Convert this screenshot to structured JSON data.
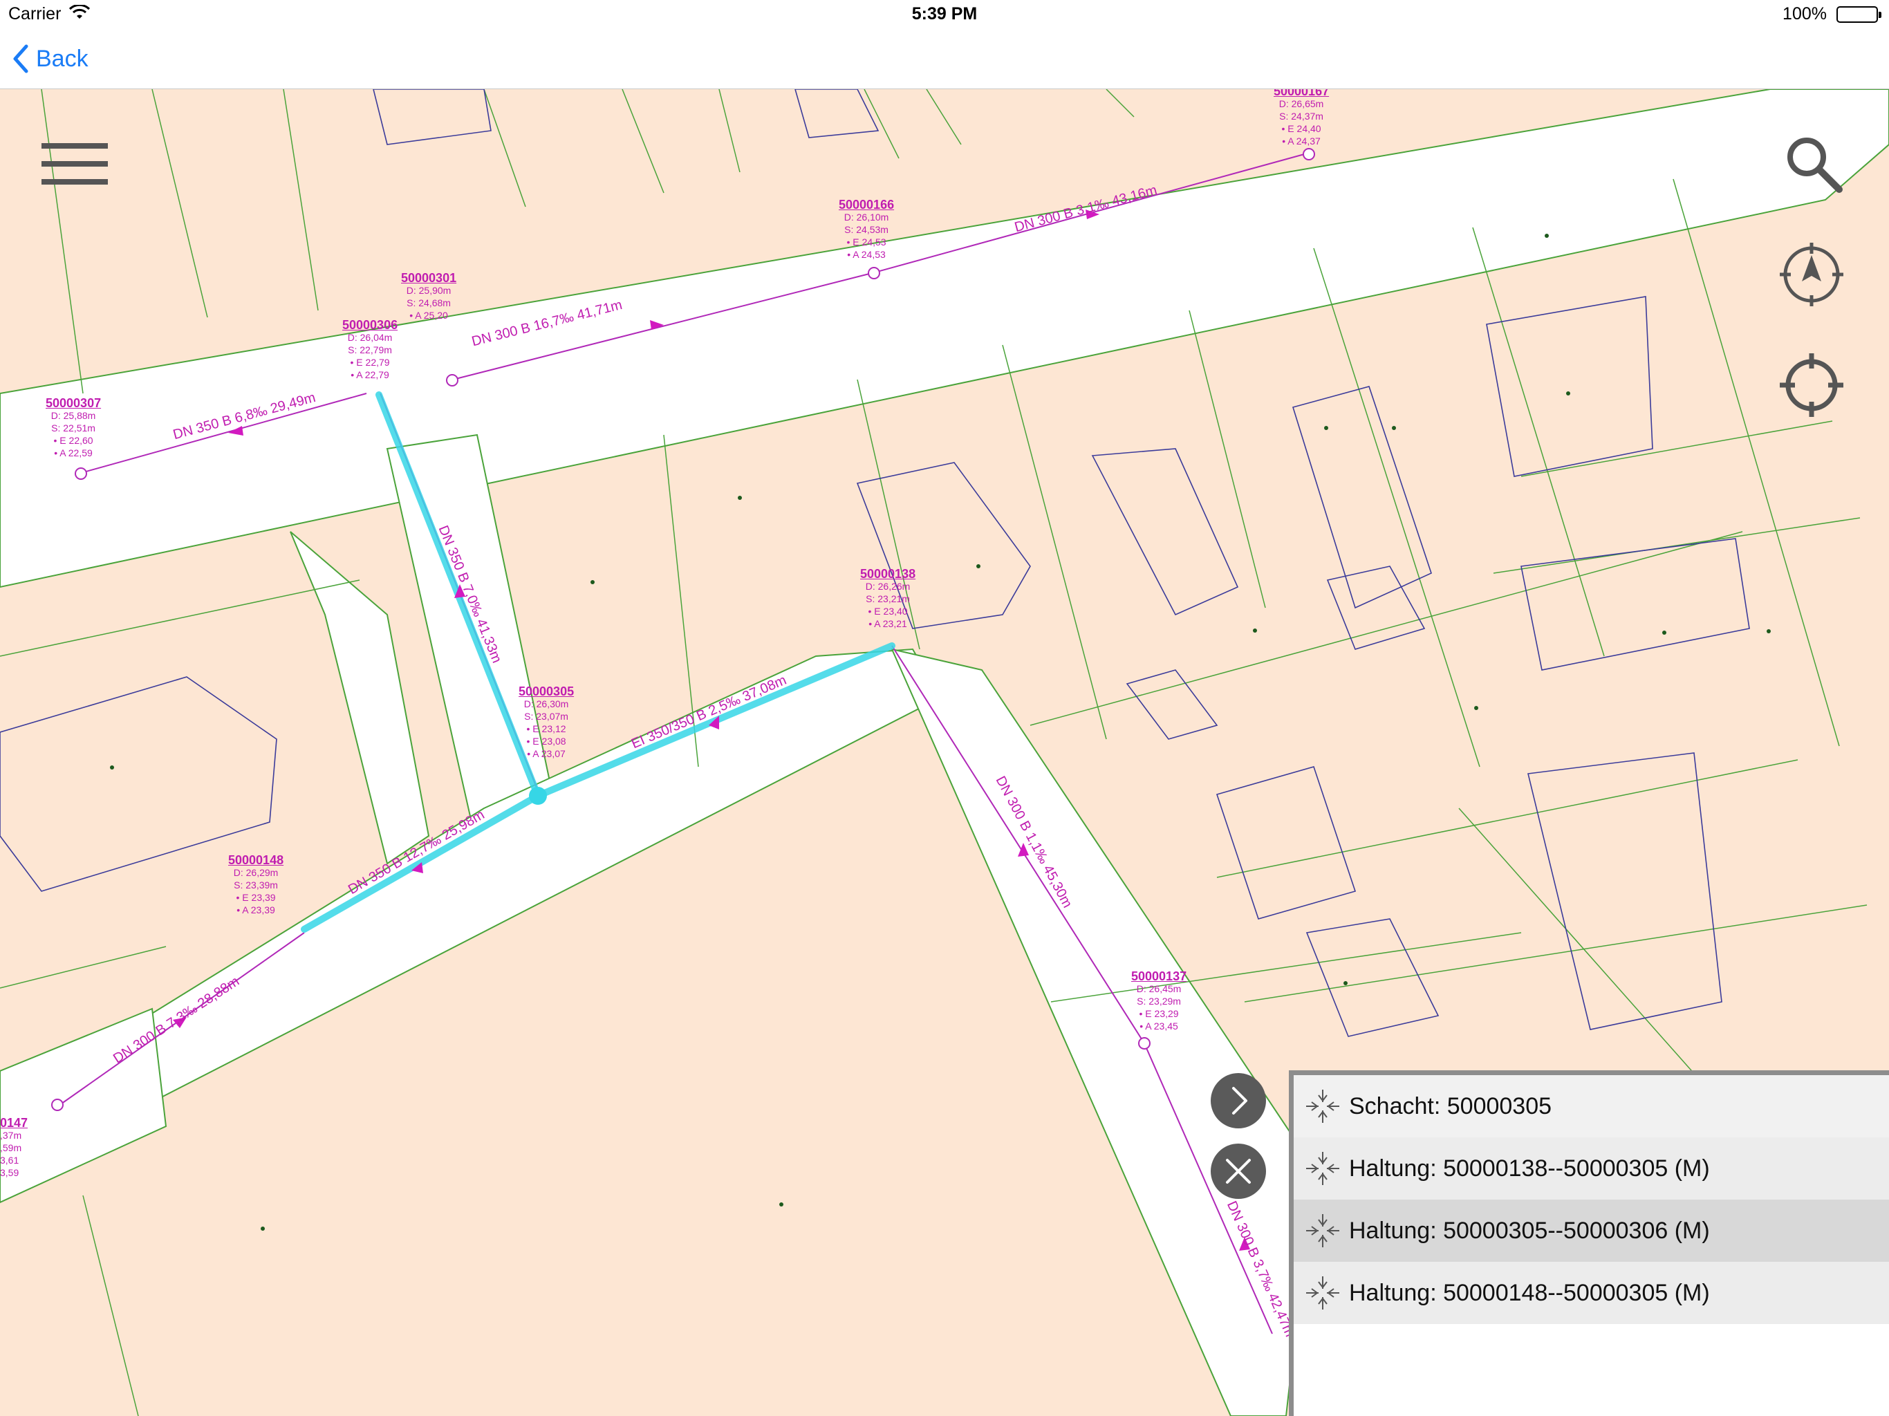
{
  "status_bar": {
    "carrier": "Carrier",
    "time": "5:39 PM",
    "battery": "100%"
  },
  "nav": {
    "back_label": "Back"
  },
  "map": {
    "manholes": [
      {
        "id": "50000301",
        "details": [
          "D: 25,90m",
          "S: 24,68m",
          "• A 25,20"
        ]
      },
      {
        "id": "50000306",
        "details": [
          "D: 26,04m",
          "S: 22,79m",
          "• E 22,79",
          "• A 22,79"
        ]
      },
      {
        "id": "50000307",
        "details": [
          "D: 25,88m",
          "S: 22,51m",
          "• E 22,60",
          "• A 22,59"
        ]
      },
      {
        "id": "50000166",
        "details": [
          "D: 26,10m",
          "S: 24,53m",
          "• E 24,53",
          "• A 24,53"
        ]
      },
      {
        "id": "50000167",
        "details": [
          "D: 26,65m",
          "S: 24,37m",
          "• E 24,40",
          "• A 24,37"
        ]
      },
      {
        "id": "50000138",
        "details": [
          "D: 26,26m",
          "S: 23,21m",
          "• E 23,40",
          "• A 23,21"
        ]
      },
      {
        "id": "50000305",
        "details": [
          "D: 26,30m",
          "S: 23,07m",
          "• E 23,12",
          "• E 23,08",
          "• A 23,07"
        ]
      },
      {
        "id": "50000148",
        "details": [
          "D: 26,29m",
          "S: 23,39m",
          "• E 23,39",
          "• A 23,39"
        ]
      },
      {
        "id": "50000137",
        "details": [
          "D: 26,45m",
          "S: 23,29m",
          "• E 23,29",
          "• A 23,45"
        ]
      },
      {
        "id": "0147",
        "details": [
          ",37m",
          ",59m",
          "3,61",
          "3,59"
        ]
      }
    ],
    "pipes": [
      "DN 300 B 16,7‰ 41,71m",
      "DN 300 B 3,1‰ 43,16m",
      "DN 350 B 6,8‰ 29,49m",
      "DN 350 B 7,0‰ 41,33m",
      "EI 350/350 B 2,5‰ 37,08m",
      "DN 350 B 12,7‰ 25,98m",
      "DN 300 B 7,3‰ 28,88m",
      "DN 300 B 1,1‰ 45,30m",
      "DN 300 B 3,7‰ 42,47m"
    ],
    "colors": {
      "parcel": "#fde6d3",
      "street": "#ffffff",
      "parcel_line": "#4aa33a",
      "building_line": "#3b3b9a",
      "sewer": "#b028b8",
      "label": "#c01db0",
      "highlight": "#36d6e6"
    }
  },
  "controls": {
    "menu_icon": "hamburger-icon",
    "search_icon": "search-icon",
    "compass_icon": "compass-icon",
    "locate_icon": "crosshair-icon",
    "expand_icon": "chevron-right-icon",
    "close_icon": "close-icon"
  },
  "results": [
    {
      "label": "Schacht: 50000305"
    },
    {
      "label": "Haltung: 50000138--50000305 (M)"
    },
    {
      "label": "Haltung: 50000305--50000306 (M)"
    },
    {
      "label": "Haltung: 50000148--50000305 (M)"
    }
  ]
}
